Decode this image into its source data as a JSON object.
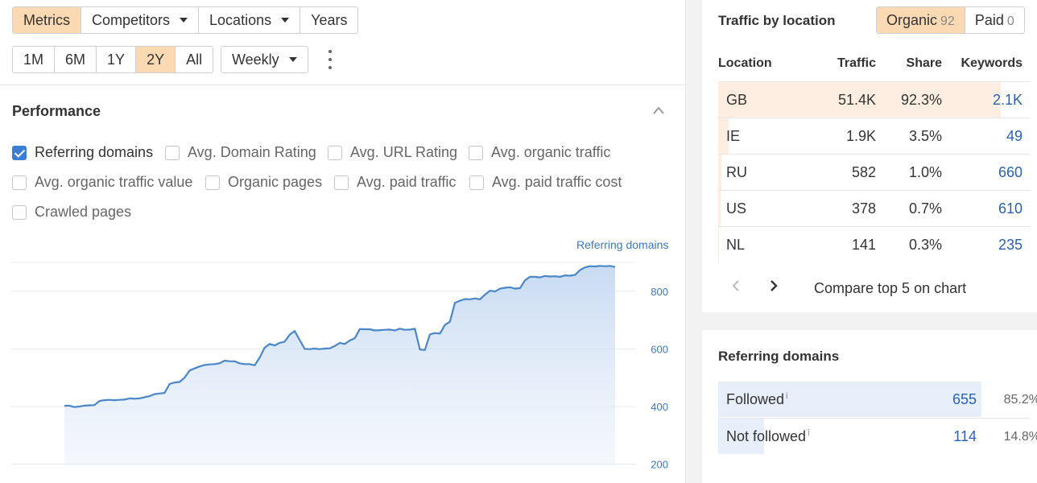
{
  "toolbar": {
    "tabs": [
      "Metrics",
      "Competitors",
      "Locations",
      "Years"
    ],
    "ranges": [
      "1M",
      "6M",
      "1Y",
      "2Y",
      "All"
    ],
    "interval": "Weekly"
  },
  "performance": {
    "title": "Performance",
    "checkboxes": [
      {
        "label": "Referring domains",
        "checked": true
      },
      {
        "label": "Avg. Domain Rating",
        "checked": false
      },
      {
        "label": "Avg. URL Rating",
        "checked": false
      },
      {
        "label": "Avg. organic traffic",
        "checked": false
      },
      {
        "label": "Avg. organic traffic value",
        "checked": false
      },
      {
        "label": "Organic pages",
        "checked": false
      },
      {
        "label": "Avg. paid traffic",
        "checked": false
      },
      {
        "label": "Avg. paid traffic cost",
        "checked": false
      },
      {
        "label": "Crawled pages",
        "checked": false
      }
    ]
  },
  "chart_data": {
    "type": "area",
    "series": [
      {
        "name": "Referring domains",
        "values": [
          402,
          403,
          398,
          400,
          403,
          404,
          405,
          419,
          422,
          423,
          422,
          423,
          424,
          428,
          427,
          428,
          432,
          436,
          443,
          445,
          447,
          478,
          483,
          485,
          500,
          525,
          532,
          539,
          544,
          546,
          547,
          550,
          559,
          557,
          557,
          550,
          547,
          547,
          543,
          570,
          604,
          617,
          612,
          621,
          625,
          649,
          662,
          630,
          600,
          599,
          601,
          599,
          601,
          602,
          610,
          621,
          617,
          629,
          637,
          669,
          668,
          668,
          664,
          665,
          666,
          667,
          664,
          670,
          666,
          667,
          670,
          598,
          596,
          650,
          655,
          653,
          683,
          694,
          760,
          767,
          773,
          772,
          775,
          772,
          788,
          802,
          799,
          809,
          812,
          814,
          809,
          811,
          838,
          850,
          850,
          848,
          853,
          851,
          852,
          850,
          855,
          854,
          857,
          874,
          883,
          887,
          886,
          888,
          887,
          888,
          884
        ]
      }
    ],
    "y_ticks": [
      800,
      600,
      400,
      200
    ],
    "ylim": [
      140,
      900
    ],
    "grid": true,
    "legend": "top-right"
  },
  "traffic": {
    "title": "Traffic by location",
    "organic_label": "Organic",
    "organic_count": "92",
    "paid_label": "Paid",
    "paid_count": "0",
    "columns": [
      "Location",
      "Traffic",
      "Share",
      "Keywords"
    ],
    "rows": [
      {
        "location": "GB",
        "traffic": "51.4K",
        "share": "92.3%",
        "keywords": "2.1K",
        "share_value": 92.3
      },
      {
        "location": "IE",
        "traffic": "1.9K",
        "share": "3.5%",
        "keywords": "49",
        "share_value": 3.5
      },
      {
        "location": "RU",
        "traffic": "582",
        "share": "1.0%",
        "keywords": "660",
        "share_value": 1.0
      },
      {
        "location": "US",
        "traffic": "378",
        "share": "0.7%",
        "keywords": "610",
        "share_value": 0.7
      },
      {
        "location": "NL",
        "traffic": "141",
        "share": "0.3%",
        "keywords": "235",
        "share_value": 0.3
      }
    ],
    "compare_label": "Compare top 5 on chart"
  },
  "referring": {
    "title": "Referring domains",
    "rows": [
      {
        "label": "Followed",
        "info": "i",
        "value": "655",
        "pct": "85.2%",
        "share_value": 85.2
      },
      {
        "label": "Not followed",
        "info": "i",
        "value": "114",
        "pct": "14.8%",
        "share_value": 14.8
      }
    ]
  },
  "colors": {
    "accent": "#fbd9b3",
    "line": "#4a86c8",
    "link": "#2a62ad"
  }
}
